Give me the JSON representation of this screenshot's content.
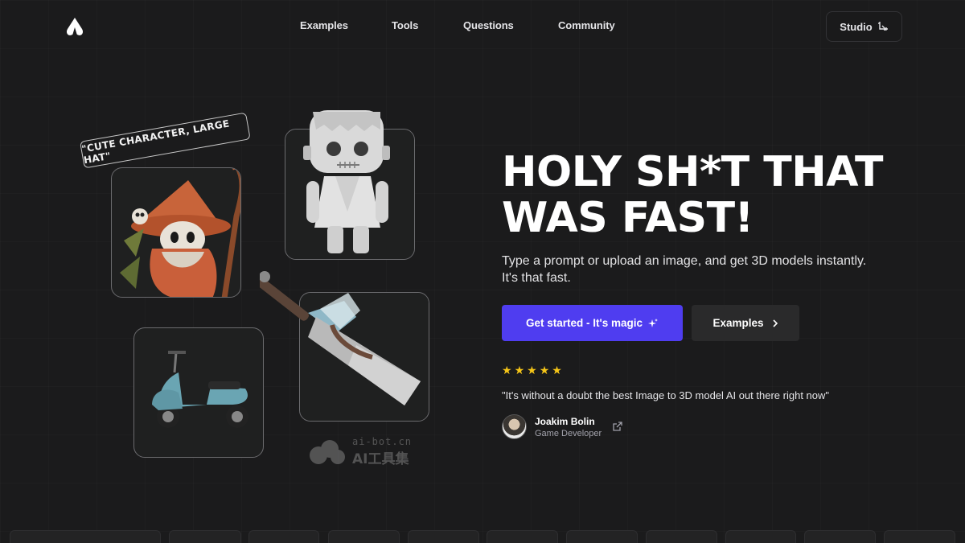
{
  "nav": {
    "links": [
      "Examples",
      "Tools",
      "Questions",
      "Community"
    ],
    "studio_label": "Studio"
  },
  "showcase": {
    "tag_text": "\"CUTE CHARACTER, LARGE HAT\""
  },
  "hero": {
    "title_line1": "HOLY SH*T THAT",
    "title_line2": "WAS FAST!",
    "subtitle_line1": "Type a prompt or upload an image, and get 3D models instantly.",
    "subtitle_line2": "It's that fast.",
    "primary_button": "Get started - It's magic",
    "secondary_button": "Examples"
  },
  "testimonial": {
    "rating": 5,
    "quote": "\"It's without a doubt the best Image to 3D model AI out there right now\"",
    "author_name": "Joakim Bolin",
    "author_role": "Game Developer"
  },
  "watermark": {
    "line1": "ai-bot.cn",
    "line2": "AI工具集"
  },
  "colors": {
    "background": "#1b1b1c",
    "accent": "#4f3df0",
    "star": "#f5c518"
  }
}
